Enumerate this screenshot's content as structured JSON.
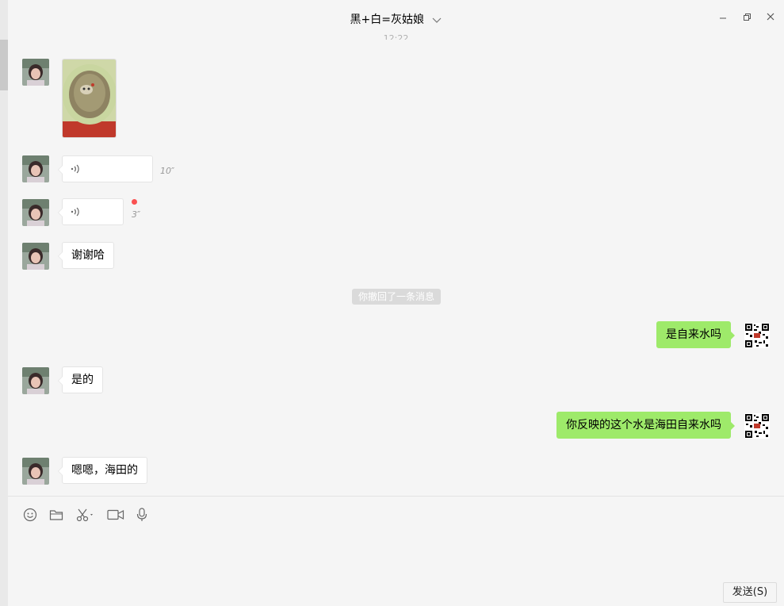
{
  "window": {
    "title": "黑+白=灰姑娘",
    "title_icon": "chevron-down-icon",
    "controls": [
      "minimize-icon",
      "restore-icon",
      "close-icon"
    ]
  },
  "clipped_timestamp": "12:22",
  "messages": [
    {
      "side": "left",
      "type": "image"
    },
    {
      "side": "left",
      "type": "voice",
      "duration": "10″"
    },
    {
      "side": "left",
      "type": "voice",
      "duration": "3″",
      "unread": true
    },
    {
      "side": "left",
      "type": "text",
      "text": "谢谢哈"
    },
    {
      "type": "system",
      "text": "你撤回了一条消息"
    },
    {
      "side": "right",
      "type": "text",
      "text": "是自来水吗"
    },
    {
      "side": "left",
      "type": "text",
      "text": "是的"
    },
    {
      "side": "right",
      "type": "text",
      "text": "你反映的这个水是海田自来水吗"
    },
    {
      "side": "left",
      "type": "text",
      "text": "嗯嗯，海田的"
    }
  ],
  "toolbar": {
    "icons": [
      "emoji-icon",
      "folder-icon",
      "scissors-icon",
      "video-call-icon",
      "microphone-icon"
    ]
  },
  "composer": {
    "send_label": "发送(S)"
  },
  "colors": {
    "sent_bubble": "#9eea6a",
    "received_bubble": "#ffffff",
    "background": "#f5f5f5",
    "unread_dot": "#fa5151"
  }
}
